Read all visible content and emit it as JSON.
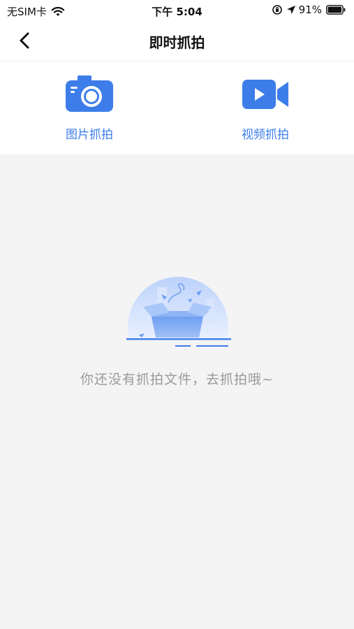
{
  "status_bar": {
    "carrier": "无SIM卡",
    "time": "下午 5:04",
    "battery": "91%"
  },
  "nav": {
    "title": "即时抓拍",
    "back_icon": "chevron-left-icon"
  },
  "capture_options": [
    {
      "label": "图片抓拍",
      "icon": "camera-icon"
    },
    {
      "label": "视频抓拍",
      "icon": "video-camera-icon"
    }
  ],
  "empty_state": {
    "message": "你还没有抓拍文件，去抓拍哦~",
    "icon": "empty-box-illustration"
  },
  "colors": {
    "accent": "#3d7de9",
    "background": "#f4f4f5",
    "muted_text": "#9a9a9a"
  }
}
